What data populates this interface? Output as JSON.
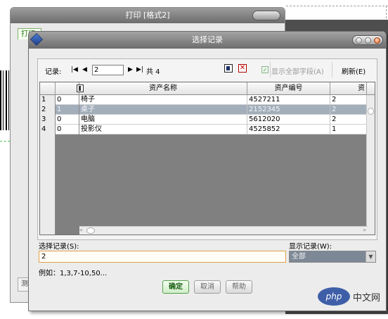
{
  "background_window": {
    "title": "打印 [格式2]",
    "tab_label": "打印",
    "button_label": "测"
  },
  "dialog": {
    "title": "选择记录",
    "nav": {
      "record_label": "记录:",
      "current_record": "2",
      "total_text": "共 4",
      "first_icon": "first-record-icon",
      "prev_icon": "prev-record-icon",
      "next_icon": "next-record-icon",
      "last_icon": "last-record-icon"
    },
    "show_all_fields_label": "显示全部字段(A)",
    "refresh_label": "刷新(E)",
    "grid": {
      "columns": [
        "资产名称",
        "资产编号",
        "资"
      ],
      "rows": [
        {
          "num": "1",
          "flag": "0",
          "name": "椅子",
          "code": "4527211",
          "extra": "2"
        },
        {
          "num": "2",
          "flag": "1",
          "name": "桌子",
          "code": "2152345",
          "extra": "2"
        },
        {
          "num": "3",
          "flag": "0",
          "name": "电脑",
          "code": "5612020",
          "extra": "2"
        },
        {
          "num": "4",
          "flag": "0",
          "name": "投影仪",
          "code": "4525852",
          "extra": "1"
        }
      ],
      "selected_row_index": 1
    },
    "select_records_label": "选择记录(S):",
    "select_records_value": "2",
    "show_records_label": "显示记录(W):",
    "show_records_value": "全部",
    "example_text": "例如：1,3,7-10,50...",
    "buttons": {
      "ok": "确定",
      "cancel": "取消",
      "help": "帮助"
    }
  },
  "watermark": {
    "logo_text": "php",
    "site_text": "中文网"
  },
  "colors": {
    "title_bar": "#6d6d6d",
    "selected_row": "#a3aebb",
    "grid_empty": "#808080",
    "primary_button": "#55a04a",
    "input_focus_border": "#e0a24a"
  }
}
